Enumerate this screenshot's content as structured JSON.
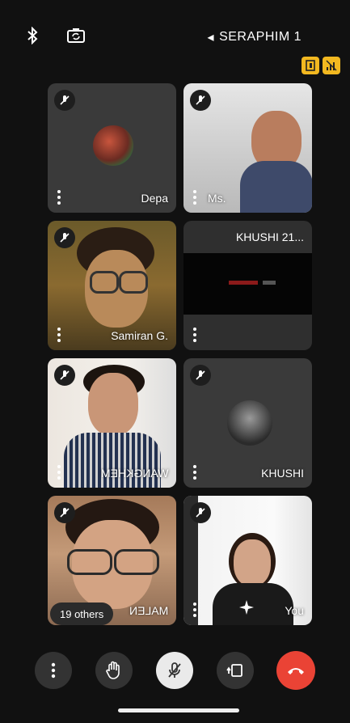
{
  "header": {
    "meeting_title": "SERAPHIM 1",
    "chevron": "◂"
  },
  "icons": {
    "bluetooth": "bluetooth-icon",
    "switch_camera": "switch-camera-icon",
    "badge1": "transcript-icon",
    "badge2": "signal-icon"
  },
  "tiles": [
    {
      "name": "Depa",
      "muted": true
    },
    {
      "name": "Ms.",
      "muted": true
    },
    {
      "name": "Samiran G.",
      "muted": true
    },
    {
      "name": "KHUSHI 21...",
      "muted": false
    },
    {
      "name": "WANGKHEM",
      "muted": true
    },
    {
      "name": "KHUSHI",
      "muted": true
    },
    {
      "name": "MALEN",
      "muted": true
    },
    {
      "name": "You",
      "muted": true
    }
  ],
  "others_label": "19 others",
  "controls": [
    "more-options",
    "raise-hand",
    "microphone-off",
    "share-screen",
    "end-call"
  ],
  "colors": {
    "end_call": "#ea4335",
    "badge": "#f2b820",
    "tile": "#3a3a3a"
  }
}
